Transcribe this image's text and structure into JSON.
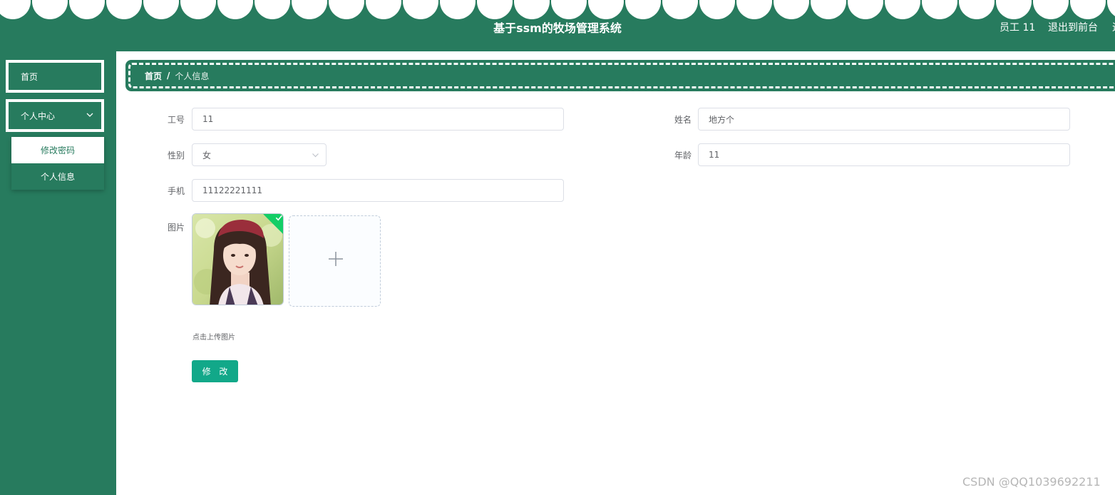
{
  "header": {
    "title": "基于ssm的牧场管理系统",
    "user_label": "员工 11",
    "exit_label": "退出到前台",
    "edge_label": "退"
  },
  "sidebar": {
    "home_label": "首页",
    "personal_center_label": "个人中心",
    "submenu": [
      {
        "label": "修改密码"
      },
      {
        "label": "个人信息"
      }
    ]
  },
  "breadcrumb": {
    "home": "首页",
    "separator": "/",
    "current": "个人信息"
  },
  "form": {
    "employee_no": {
      "label": "工号",
      "value": "11"
    },
    "name": {
      "label": "姓名",
      "value": "地方个"
    },
    "gender": {
      "label": "性别",
      "value": "女"
    },
    "age": {
      "label": "年龄",
      "value": "11"
    },
    "phone": {
      "label": "手机",
      "value": "11122221111"
    },
    "photo": {
      "label": "图片",
      "tip": "点击上传图片"
    },
    "submit_label": "修 改"
  },
  "watermark": "CSDN @QQ1039692211",
  "colors": {
    "primary_green": "#277b5e",
    "button_teal": "#12a889",
    "success_check": "#13ce66"
  },
  "icons": {
    "chevron": "chevron-down-icon",
    "upload": "plus-icon",
    "uploaded": "check-icon"
  }
}
